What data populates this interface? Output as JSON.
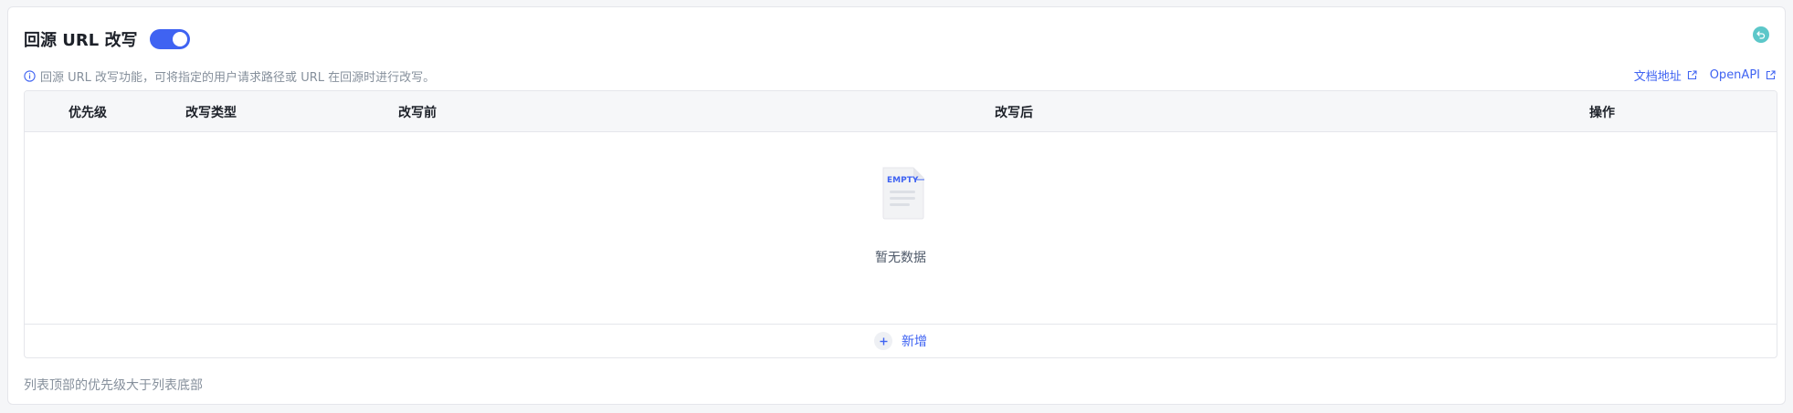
{
  "header": {
    "title": "回源 URL 改写",
    "toggle_on": true,
    "reset_icon": "undo-icon"
  },
  "info": {
    "icon": "info-icon",
    "text": "回源 URL 改写功能，可将指定的用户请求路径或 URL 在回源时进行改写。"
  },
  "links": {
    "docs_label": "文档地址",
    "openapi_label": "OpenAPI",
    "icon": "external-link-icon"
  },
  "table": {
    "columns": [
      "优先级",
      "改写类型",
      "改写前",
      "改写后",
      "操作"
    ],
    "rows": [],
    "empty_illustration_text": "EMPTY",
    "empty_text": "暂无数据",
    "add_label": "新增"
  },
  "footer": {
    "note": "列表顶部的优先级大于列表底部"
  },
  "colors": {
    "accent": "#3f63f2",
    "reset_button": "#5cc7c9"
  }
}
